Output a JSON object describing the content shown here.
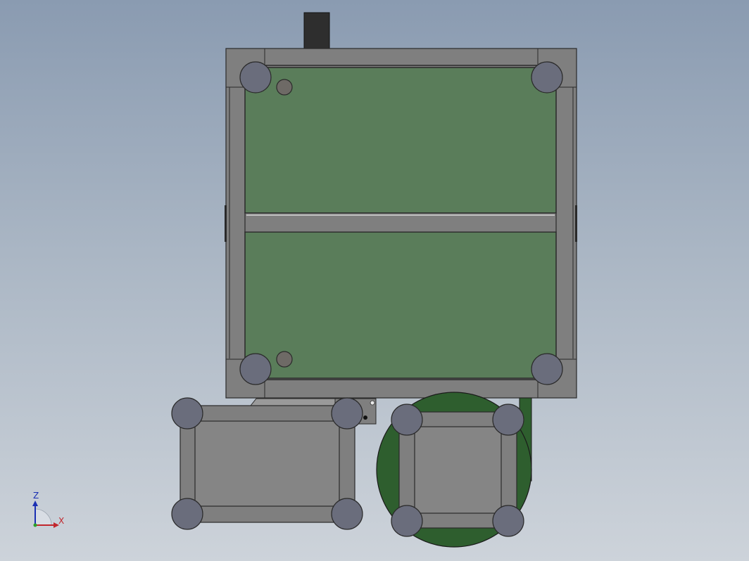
{
  "viewport": {
    "background_top": "#8a9bb1",
    "background_bottom": "#cdd3da"
  },
  "colors": {
    "frame": "#7f7f7f",
    "frame_edge": "#2a2a2a",
    "panel": "#5a7d5a",
    "foot": "#6a6d7c",
    "hole": "#6e6a66",
    "motor_block": "#2e2e2e",
    "disc": "#2e5e2e",
    "axis_x": "#c1272d",
    "axis_z": "#1a2fb3",
    "axis_y": "#2aa02a"
  },
  "triad": {
    "z_label": "Z",
    "x_label": "X"
  }
}
